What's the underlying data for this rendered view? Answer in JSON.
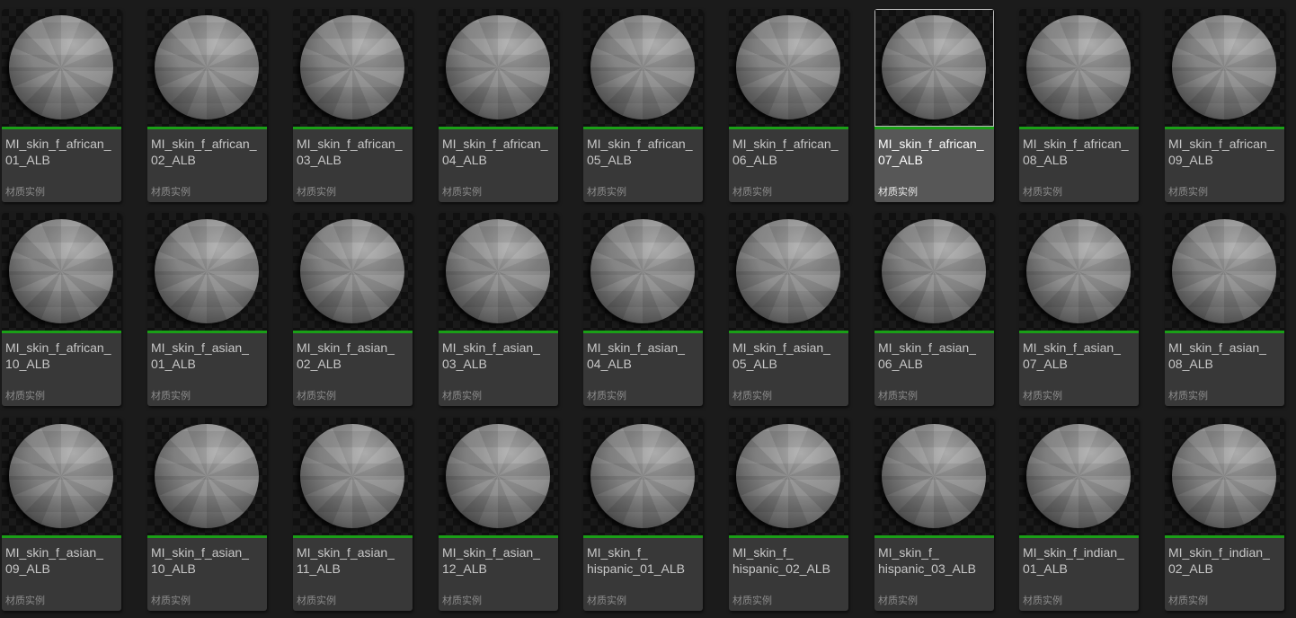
{
  "asset_type_label": "材质实例",
  "colors": {
    "background": "#1b1b1b",
    "tile": "#383838",
    "tile_selected": "#575757",
    "type_bar_material_instance": "#1a9f17"
  },
  "assets": [
    {
      "name": "MI_skin_f_african_\n01_ALB",
      "selected": false
    },
    {
      "name": "MI_skin_f_african_\n02_ALB",
      "selected": false
    },
    {
      "name": "MI_skin_f_african_\n03_ALB",
      "selected": false
    },
    {
      "name": "MI_skin_f_african_\n04_ALB",
      "selected": false
    },
    {
      "name": "MI_skin_f_african_\n05_ALB",
      "selected": false
    },
    {
      "name": "MI_skin_f_african_\n06_ALB",
      "selected": false
    },
    {
      "name": "MI_skin_f_african_\n07_ALB",
      "selected": true
    },
    {
      "name": "MI_skin_f_african_\n08_ALB",
      "selected": false
    },
    {
      "name": "MI_skin_f_african_\n09_ALB",
      "selected": false
    },
    {
      "name": "MI_skin_f_african_\n10_ALB",
      "selected": false
    },
    {
      "name": "MI_skin_f_asian_\n01_ALB",
      "selected": false
    },
    {
      "name": "MI_skin_f_asian_\n02_ALB",
      "selected": false
    },
    {
      "name": "MI_skin_f_asian_\n03_ALB",
      "selected": false
    },
    {
      "name": "MI_skin_f_asian_\n04_ALB",
      "selected": false
    },
    {
      "name": "MI_skin_f_asian_\n05_ALB",
      "selected": false
    },
    {
      "name": "MI_skin_f_asian_\n06_ALB",
      "selected": false
    },
    {
      "name": "MI_skin_f_asian_\n07_ALB",
      "selected": false
    },
    {
      "name": "MI_skin_f_asian_\n08_ALB",
      "selected": false
    },
    {
      "name": "MI_skin_f_asian_\n09_ALB",
      "selected": false
    },
    {
      "name": "MI_skin_f_asian_\n10_ALB",
      "selected": false
    },
    {
      "name": "MI_skin_f_asian_\n11_ALB",
      "selected": false
    },
    {
      "name": "MI_skin_f_asian_\n12_ALB",
      "selected": false
    },
    {
      "name": "MI_skin_f_\nhispanic_01_ALB",
      "selected": false
    },
    {
      "name": "MI_skin_f_\nhispanic_02_ALB",
      "selected": false
    },
    {
      "name": "MI_skin_f_\nhispanic_03_ALB",
      "selected": false
    },
    {
      "name": "MI_skin_f_indian_\n01_ALB",
      "selected": false
    },
    {
      "name": "MI_skin_f_indian_\n02_ALB",
      "selected": false
    }
  ]
}
